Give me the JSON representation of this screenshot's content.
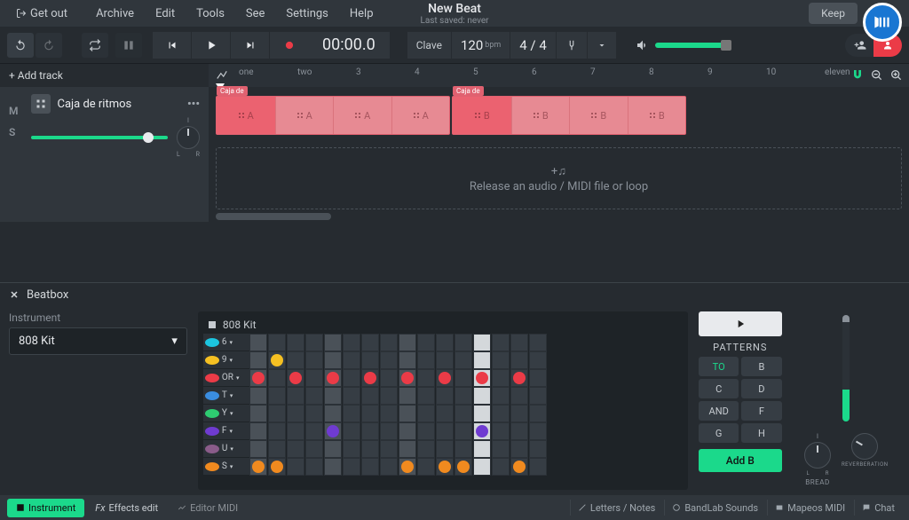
{
  "app": {
    "getOut": "Get out",
    "menu": [
      "Archive",
      "Edit",
      "Tools",
      "See",
      "Settings",
      "Help"
    ],
    "title": "New Beat",
    "subtitle": "Last saved: never",
    "keep": "Keep"
  },
  "transport": {
    "time": "00:00.0",
    "keyLabel": "Clave",
    "bpm": "120",
    "bpmUnit": "bpm",
    "timeSig": "4 / 4"
  },
  "timeline": {
    "addTrack": "+ Add track",
    "labels": [
      "one",
      "two",
      "3",
      "4",
      "5",
      "6",
      "7",
      "8",
      "9",
      "10",
      "eleven"
    ]
  },
  "track": {
    "name": "Caja de ritmos",
    "mute": "M",
    "solo": "S",
    "panI": "I",
    "panL": "L",
    "panR": "R",
    "clipA": "Caja de",
    "clipB": "Caja de",
    "clipAcell": "A",
    "clipBcell": "B",
    "dropHint": "Release an audio / MIDI file or loop",
    "plusIcon": "+♫"
  },
  "beatbox": {
    "title": "Beatbox",
    "instLabel": "Instrument",
    "instValue": "808 Kit",
    "kitHeader": "808 Kit",
    "rows": [
      {
        "name": "6",
        "color": "#1cc5e0",
        "dots": []
      },
      {
        "name": "9",
        "color": "#f5c022",
        "dots": [
          {
            "i": 1,
            "c": "#f5c022"
          }
        ]
      },
      {
        "name": "OR",
        "color": "#eb3b47",
        "dots": [
          {
            "i": 0,
            "c": "#eb3b47"
          },
          {
            "i": 2,
            "c": "#eb3b47"
          },
          {
            "i": 4,
            "c": "#eb3b47"
          },
          {
            "i": 6,
            "c": "#eb3b47"
          },
          {
            "i": 8,
            "c": "#eb3b47"
          },
          {
            "i": 10,
            "c": "#eb3b47"
          },
          {
            "i": 12,
            "c": "#eb3b47"
          },
          {
            "i": 14,
            "c": "#eb3b47"
          }
        ]
      },
      {
        "name": "T",
        "color": "#3a8de0",
        "dots": []
      },
      {
        "name": "Y",
        "color": "#2ecb71",
        "dots": []
      },
      {
        "name": "F",
        "color": "#6f3bd1",
        "dots": [
          {
            "i": 4,
            "c": "#6f3bd1"
          },
          {
            "i": 12,
            "c": "#6f3bd1"
          }
        ]
      },
      {
        "name": "U",
        "color": "#8a5c8a",
        "dots": []
      },
      {
        "name": "S",
        "color": "#f08a1f",
        "dots": [
          {
            "i": 0,
            "c": "#f08a1f"
          },
          {
            "i": 1,
            "c": "#f08a1f"
          },
          {
            "i": 8,
            "c": "#f08a1f"
          },
          {
            "i": 10,
            "c": "#f08a1f"
          },
          {
            "i": 11,
            "c": "#f08a1f"
          },
          {
            "i": 14,
            "c": "#f08a1f"
          }
        ]
      }
    ],
    "patternsLabel": "PATTERNS",
    "patterns": [
      "TO",
      "B",
      "C",
      "D",
      "AND",
      "F",
      "G",
      "H"
    ],
    "addB": "Add B",
    "knobBread": "BREAD",
    "knobReverb": "REVERBERATION"
  },
  "bottombar": {
    "instrument": "Instrument",
    "fx": "Effects edit",
    "midi": "Editor MIDI",
    "letters": "Letters / Notes",
    "sounds": "BandLab Sounds",
    "mapeos": "Mapeos MIDI",
    "chat": "Chat",
    "fxPrefix": "Fx"
  }
}
